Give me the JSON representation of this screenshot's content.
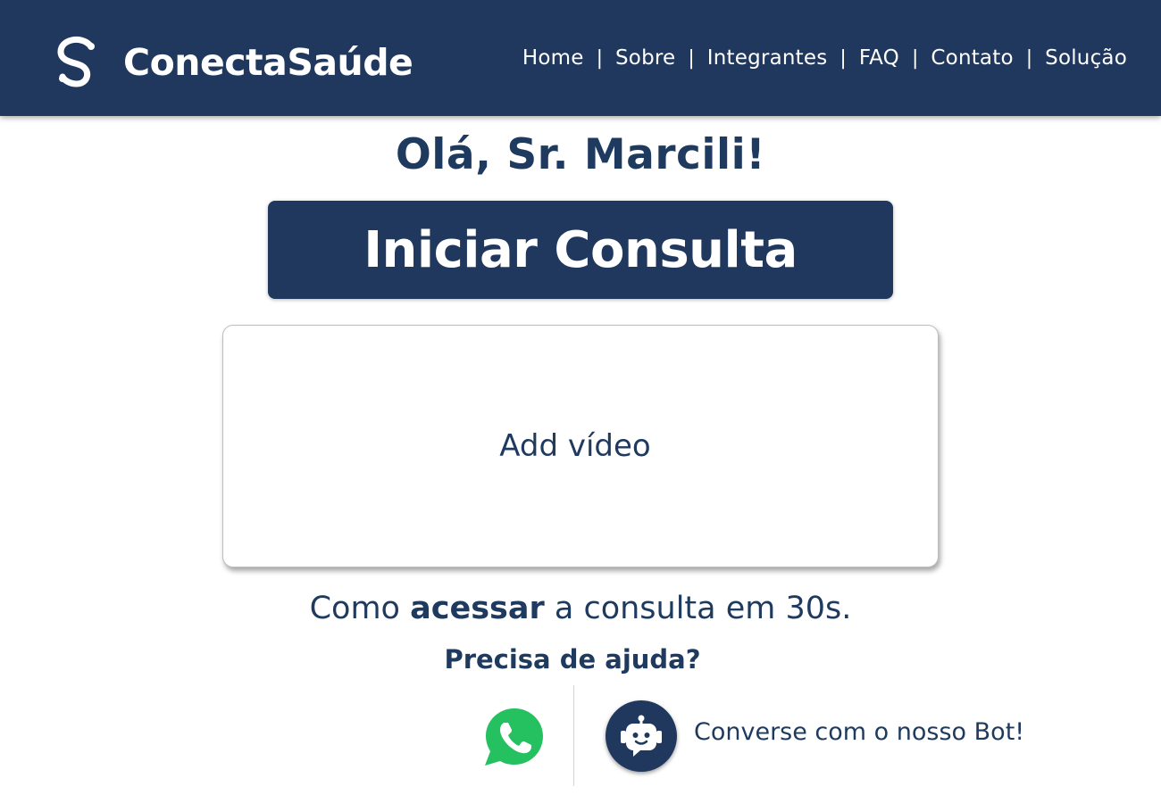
{
  "header": {
    "brand_name": "ConectaSaúde",
    "logo_icon": "conectasaude-logo-icon",
    "nav": [
      {
        "label": "Home"
      },
      {
        "label": "Sobre"
      },
      {
        "label": "Integrantes"
      },
      {
        "label": "FAQ"
      },
      {
        "label": "Contato"
      },
      {
        "label": "Solução"
      }
    ],
    "separator": "|"
  },
  "main": {
    "greeting": "Olá, Sr. Marcili!",
    "start_button_label": "Iniciar Consulta",
    "video_placeholder": "Add vídeo",
    "howto": {
      "prefix": "Como ",
      "bold": "acessar",
      "suffix": " a consulta em 30s."
    },
    "help": {
      "title": "Precisa de ajuda?",
      "whatsapp_icon": "whatsapp-icon",
      "bot_icon": "robot-icon",
      "bot_label": "Converse com o nosso Bot!"
    }
  },
  "colors": {
    "primary": "#20385d",
    "text": "#1f3a5f",
    "whatsapp": "#25c060",
    "background": "#ffffff"
  }
}
